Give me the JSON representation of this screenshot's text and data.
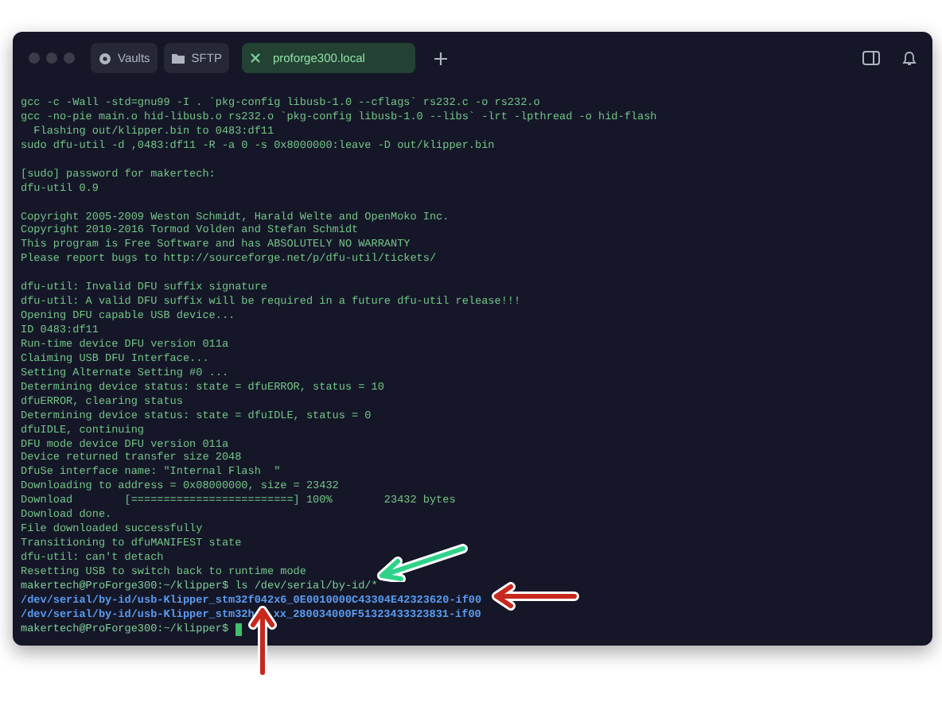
{
  "tabs": [
    {
      "label": "Vaults",
      "kind": "vault",
      "selected": false
    },
    {
      "label": "SFTP",
      "kind": "folder",
      "selected": false
    },
    {
      "label": "proforge300.local",
      "kind": "host",
      "selected": true
    }
  ],
  "terminal": {
    "lines": [
      {
        "kind": "output",
        "text": "gcc -c -Wall -std=gnu99 -I . `pkg-config libusb-1.0 --cflags` rs232.c -o rs232.o"
      },
      {
        "kind": "output",
        "text": "gcc -no-pie main.o hid-libusb.o rs232.o `pkg-config libusb-1.0 --libs` -lrt -lpthread -o hid-flash"
      },
      {
        "kind": "output",
        "text": "  Flashing out/klipper.bin to 0483:df11"
      },
      {
        "kind": "output",
        "text": "sudo dfu-util -d ,0483:df11 -R -a 0 -s 0x8000000:leave -D out/klipper.bin"
      },
      {
        "kind": "blank"
      },
      {
        "kind": "output",
        "text": "[sudo] password for makertech:"
      },
      {
        "kind": "output",
        "text": "dfu-util 0.9"
      },
      {
        "kind": "blank"
      },
      {
        "kind": "output",
        "text": "Copyright 2005-2009 Weston Schmidt, Harald Welte and OpenMoko Inc."
      },
      {
        "kind": "output",
        "text": "Copyright 2010-2016 Tormod Volden and Stefan Schmidt"
      },
      {
        "kind": "output",
        "text": "This program is Free Software and has ABSOLUTELY NO WARRANTY"
      },
      {
        "kind": "output",
        "text": "Please report bugs to http://sourceforge.net/p/dfu-util/tickets/"
      },
      {
        "kind": "blank"
      },
      {
        "kind": "output",
        "text": "dfu-util: Invalid DFU suffix signature"
      },
      {
        "kind": "output",
        "text": "dfu-util: A valid DFU suffix will be required in a future dfu-util release!!!"
      },
      {
        "kind": "output",
        "text": "Opening DFU capable USB device..."
      },
      {
        "kind": "output",
        "text": "ID 0483:df11"
      },
      {
        "kind": "output",
        "text": "Run-time device DFU version 011a"
      },
      {
        "kind": "output",
        "text": "Claiming USB DFU Interface..."
      },
      {
        "kind": "output",
        "text": "Setting Alternate Setting #0 ..."
      },
      {
        "kind": "output",
        "text": "Determining device status: state = dfuERROR, status = 10"
      },
      {
        "kind": "output",
        "text": "dfuERROR, clearing status"
      },
      {
        "kind": "output",
        "text": "Determining device status: state = dfuIDLE, status = 0"
      },
      {
        "kind": "output",
        "text": "dfuIDLE, continuing"
      },
      {
        "kind": "output",
        "text": "DFU mode device DFU version 011a"
      },
      {
        "kind": "output",
        "text": "Device returned transfer size 2048"
      },
      {
        "kind": "output",
        "text": "DfuSe interface name: \"Internal Flash  \""
      },
      {
        "kind": "output",
        "text": "Downloading to address = 0x08000000, size = 23432"
      },
      {
        "kind": "output",
        "text": "Download        [=========================] 100%        23432 bytes"
      },
      {
        "kind": "output",
        "text": "Download done."
      },
      {
        "kind": "output",
        "text": "File downloaded successfully"
      },
      {
        "kind": "output",
        "text": "Transitioning to dfuMANIFEST state"
      },
      {
        "kind": "output",
        "text": "dfu-util: can't detach"
      },
      {
        "kind": "output",
        "text": "Resetting USB to switch back to runtime mode"
      },
      {
        "kind": "prompt",
        "text": "makertech@ProForge300:~/klipper$ ls /dev/serial/by-id/*"
      },
      {
        "kind": "path",
        "text": "/dev/serial/by-id/usb-Klipper_stm32f042x6_0E0010000C43304E42323620-if00"
      },
      {
        "kind": "covered_path",
        "text": "/dev/serial/by-id/usb-Klipper_stm32h",
        "text_after": "xx_280034000F51323433323831-if00"
      },
      {
        "kind": "cursor",
        "text": "makertech@ProForge300:~/klipper$"
      }
    ]
  }
}
